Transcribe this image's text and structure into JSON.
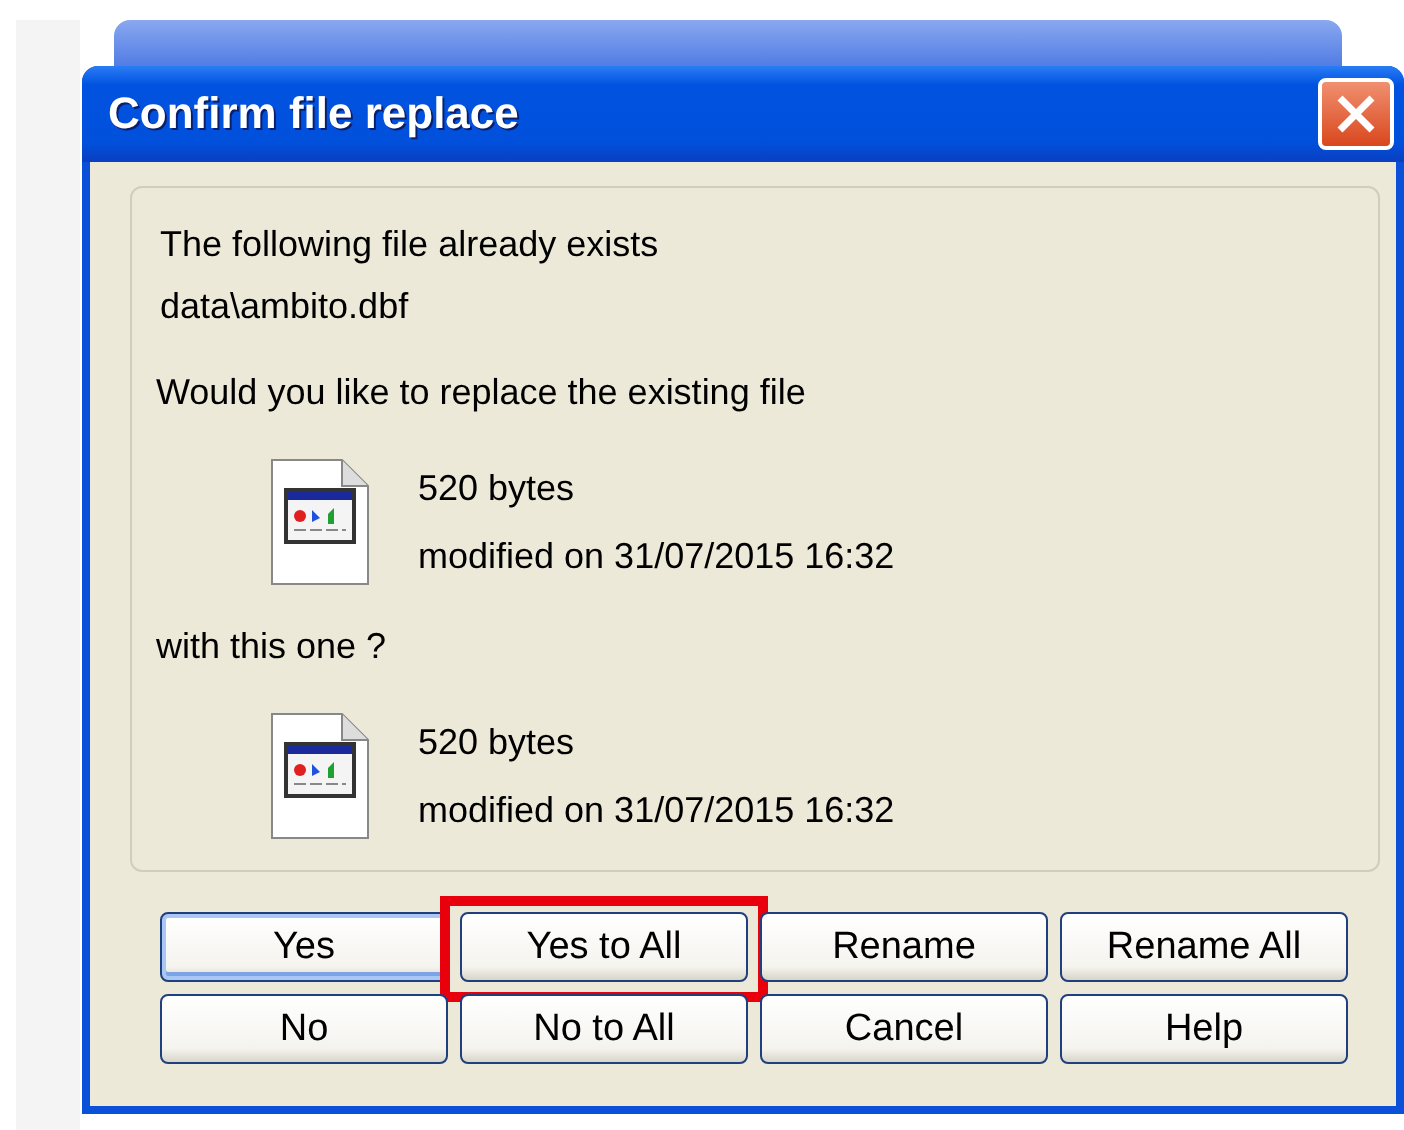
{
  "window": {
    "title": "Confirm file replace"
  },
  "message": {
    "intro": "The following file already exists",
    "path": "data\\ambito.dbf",
    "question": "Would you like to replace the existing file",
    "connector": "with this one ?"
  },
  "files": [
    {
      "size": "520 bytes",
      "modified": "modified on 31/07/2015 16:32"
    },
    {
      "size": "520 bytes",
      "modified": "modified on 31/07/2015 16:32"
    }
  ],
  "buttons": [
    {
      "label": "Yes",
      "default": true,
      "highlighted": false
    },
    {
      "label": "Yes to All",
      "default": false,
      "highlighted": true
    },
    {
      "label": "Rename",
      "default": false,
      "highlighted": false
    },
    {
      "label": "Rename All",
      "default": false,
      "highlighted": false
    },
    {
      "label": "No",
      "default": false,
      "highlighted": false
    },
    {
      "label": "No to All",
      "default": false,
      "highlighted": false
    },
    {
      "label": "Cancel",
      "default": false,
      "highlighted": false
    },
    {
      "label": "Help",
      "default": false,
      "highlighted": false
    }
  ]
}
